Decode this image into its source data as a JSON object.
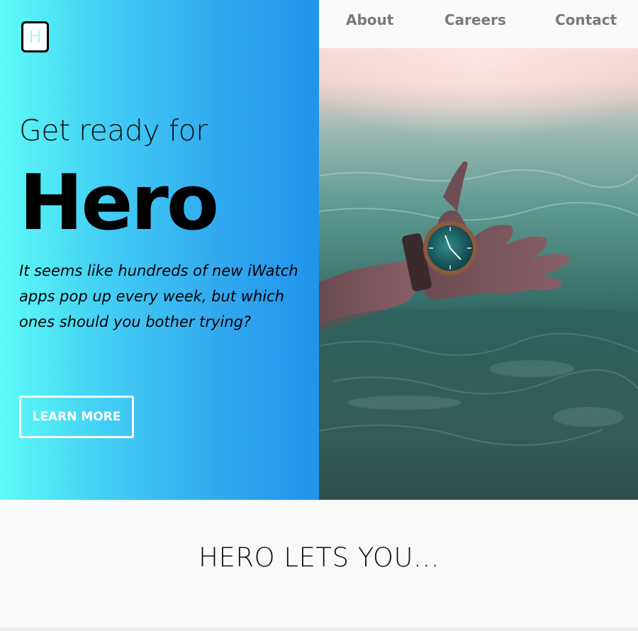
{
  "brand": {
    "logo_letter": "H"
  },
  "nav": {
    "items": [
      {
        "label": "About"
      },
      {
        "label": "Careers"
      },
      {
        "label": "Contact"
      }
    ]
  },
  "hero": {
    "kicker": "Get ready for",
    "headline": "Hero",
    "lede": "It seems like hundreds of new iWatch apps pop up every week, but which ones should you bother trying?",
    "cta_label": "LEARN MORE",
    "image_description_icon": "hand-with-watch-in-water-photo"
  },
  "section": {
    "title": "HERO LETS YOU..."
  },
  "colors": {
    "gradient_start": "#5efcf6",
    "gradient_end": "#2193ec",
    "nav_text": "#7a7a7a",
    "background": "#f9f9f9"
  }
}
